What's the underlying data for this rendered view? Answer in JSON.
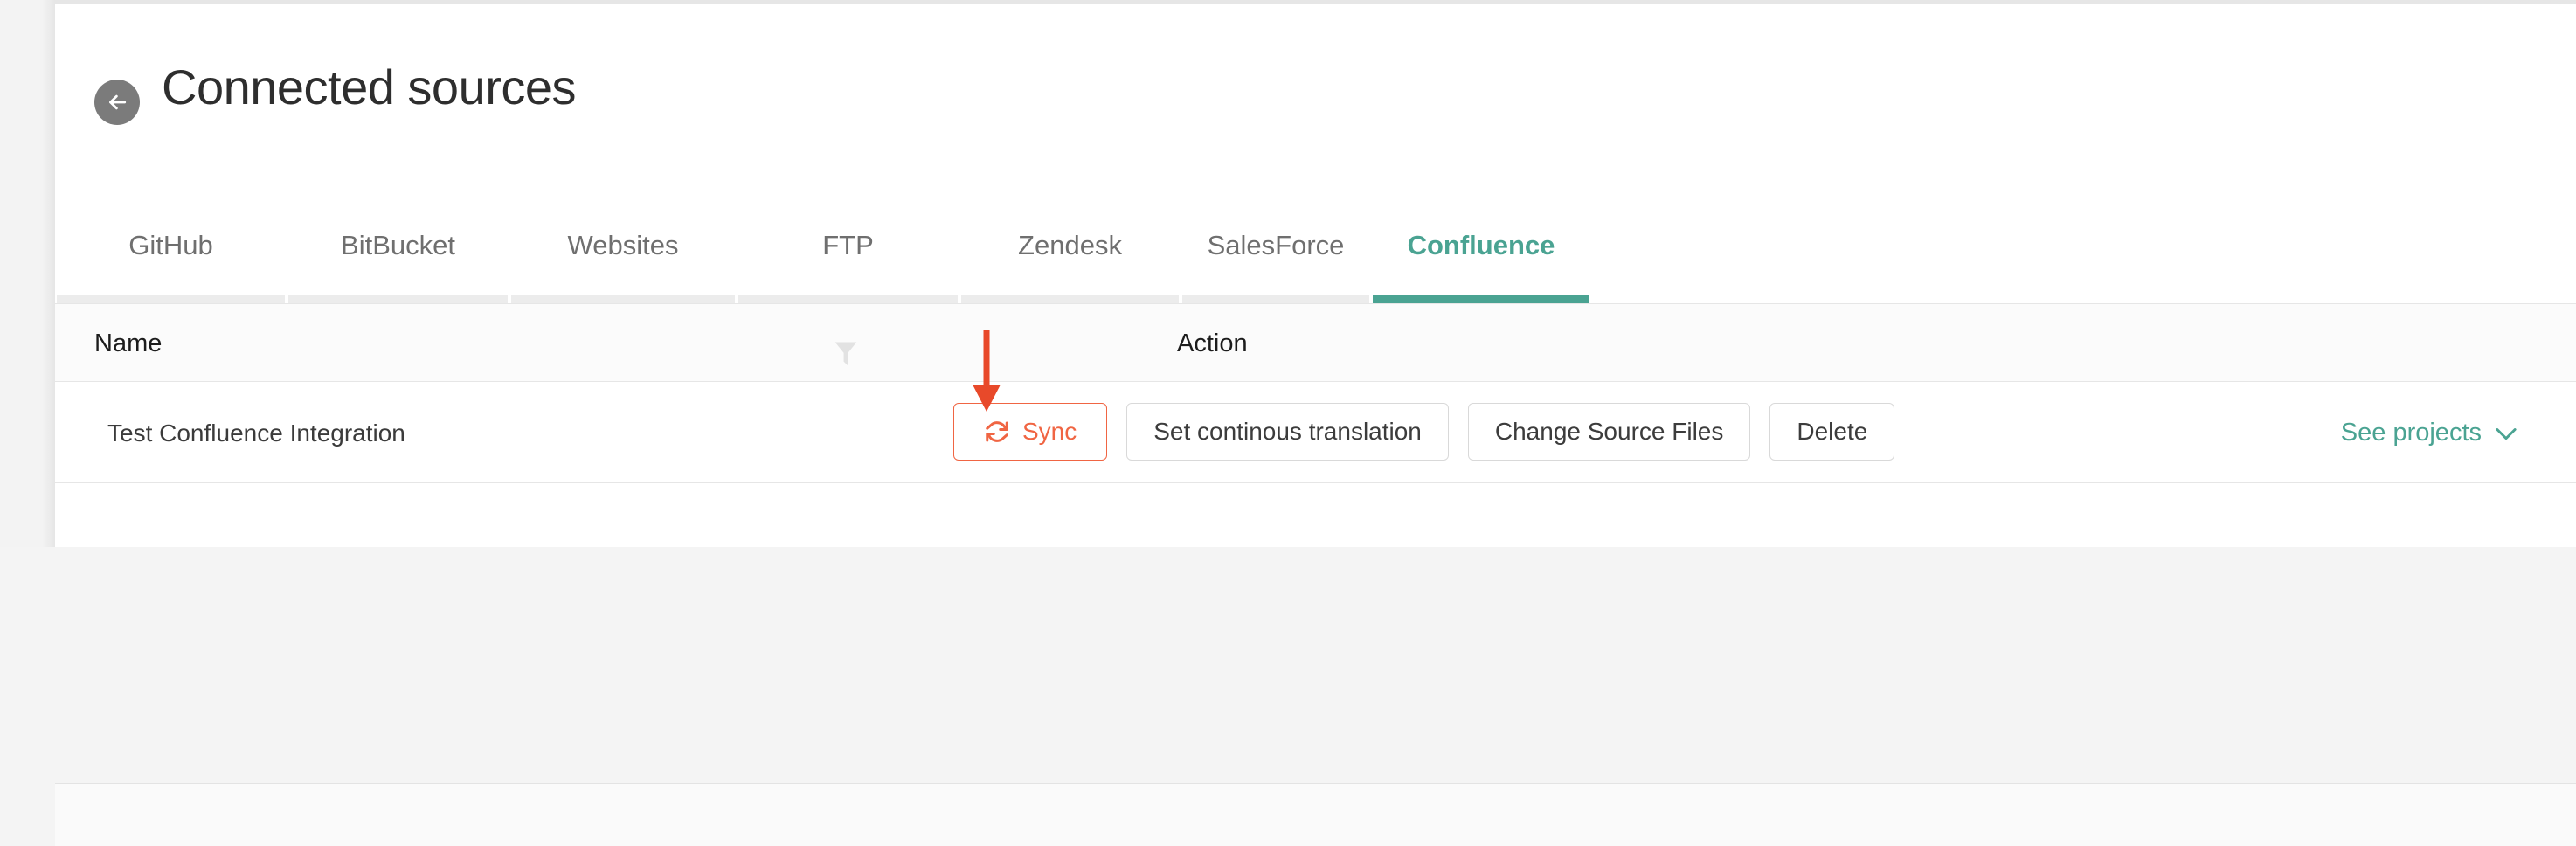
{
  "header": {
    "back_icon": "arrow-left-icon",
    "title": "Connected sources"
  },
  "tabs": [
    {
      "label": "GitHub",
      "active": false
    },
    {
      "label": "BitBucket",
      "active": false
    },
    {
      "label": "Websites",
      "active": false
    },
    {
      "label": "FTP",
      "active": false
    },
    {
      "label": "Zendesk",
      "active": false
    },
    {
      "label": "SalesForce",
      "active": false
    },
    {
      "label": "Confluence",
      "active": true
    }
  ],
  "table": {
    "columns": {
      "name": "Name",
      "action": "Action",
      "filter_icon": "filter-icon"
    },
    "rows": [
      {
        "name": "Test Confluence Integration",
        "buttons": [
          {
            "label": "Sync",
            "icon": "sync-icon",
            "style": "accent"
          },
          {
            "label": "Set continous translation",
            "icon": "",
            "style": "default"
          },
          {
            "label": "Change Source Files",
            "icon": "",
            "style": "default"
          },
          {
            "label": "Delete",
            "icon": "",
            "style": "default"
          }
        ],
        "see_projects": {
          "label": "See projects",
          "icon": "chevron-down-icon"
        }
      }
    ]
  },
  "annotation": {
    "type": "arrow-down",
    "color": "#e8492a",
    "points_to": "Sync"
  },
  "colors": {
    "accent_teal": "#4aa392",
    "accent_orange": "#f06543",
    "annotation_red": "#e8492a",
    "text_primary": "#2e2e2e",
    "text_muted": "#6f6f6f",
    "border": "#e6e6e6",
    "panel_bg": "#ffffff",
    "page_bg": "#f3f3f3"
  }
}
